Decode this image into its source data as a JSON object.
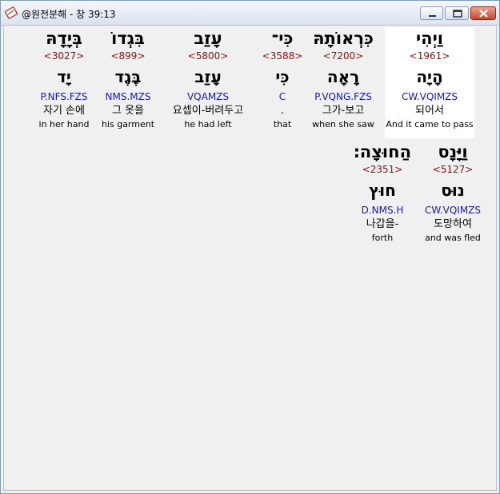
{
  "window": {
    "title": "@원전분해 - 창 39:13",
    "icon": "book-icon",
    "controls": [
      "minimize-icon",
      "maximize-icon",
      "close-icon"
    ]
  },
  "verse": {
    "rows": [
      [
        {
          "hebrew": "וַיְהִי",
          "strong": "<1961>",
          "root": "הָיָה",
          "parse": "CW.VQIMZS",
          "korean": "되어서",
          "english": "And it came to pass",
          "selected": true
        },
        {
          "hebrew": "כִּרְאוֹתָהּ",
          "strong": "<7200>",
          "root": "רָאָה",
          "parse": "P.VQNG.FZS",
          "korean": "그가-보고",
          "english": "when she saw"
        },
        {
          "hebrew": "כִּי־",
          "strong": "<3588>",
          "root": "כִּי",
          "parse": "C",
          "korean": ".",
          "english": "that"
        },
        {
          "hebrew": "עָזַב",
          "strong": "<5800>",
          "root": "עָזַב",
          "parse": "VQAMZS",
          "korean": "요셉이-버려두고",
          "english": "he had left"
        },
        {
          "hebrew": "בִּגְדוֹ",
          "strong": "<899>",
          "root": "בֶּגֶד",
          "parse": "NMS.MZS",
          "korean": "그 옷을",
          "english": "his garment"
        },
        {
          "hebrew": "בְּיָדָהּ",
          "strong": "<3027>",
          "root": "יָד",
          "parse": "P.NFS.FZS",
          "korean": "자기 손에",
          "english": "in her hand"
        }
      ],
      [
        {
          "hebrew": "וַיָּנָס",
          "strong": "<5127>",
          "root": "נוּס",
          "parse": "CW.VQIMZS",
          "korean": "도망하여",
          "english": "and was fled"
        },
        {
          "hebrew": "הַחוּצָה׃",
          "strong": "<2351>",
          "root": "חוּץ",
          "parse": "D.NMS.H",
          "korean": "나갑을-",
          "english": "forth"
        }
      ]
    ]
  }
}
